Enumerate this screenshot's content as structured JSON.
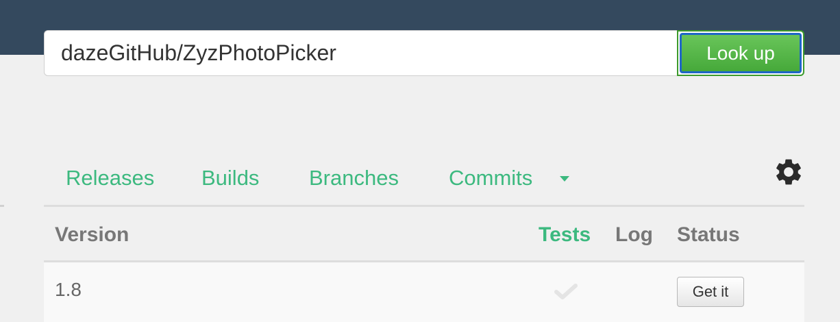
{
  "search": {
    "value": "dazeGitHub/ZyzPhotoPicker",
    "button_label": "Look up"
  },
  "tabs": {
    "items": [
      {
        "label": "Releases"
      },
      {
        "label": "Builds"
      },
      {
        "label": "Branches"
      },
      {
        "label": "Commits"
      }
    ],
    "dropdown_icon": "caret-down-icon",
    "settings_icon": "gear-icon"
  },
  "table": {
    "headers": {
      "version": "Version",
      "tests": "Tests",
      "log": "Log",
      "status": "Status"
    },
    "rows": [
      {
        "version": "1.8",
        "tests_icon": "check-icon",
        "status_button": "Get it"
      }
    ]
  },
  "colors": {
    "topbar": "#34495e",
    "accent_green": "#3cb97f",
    "button_green": "#5cb85c",
    "focus_blue": "#1f66c7",
    "check_faded": "#e4e4e4"
  }
}
